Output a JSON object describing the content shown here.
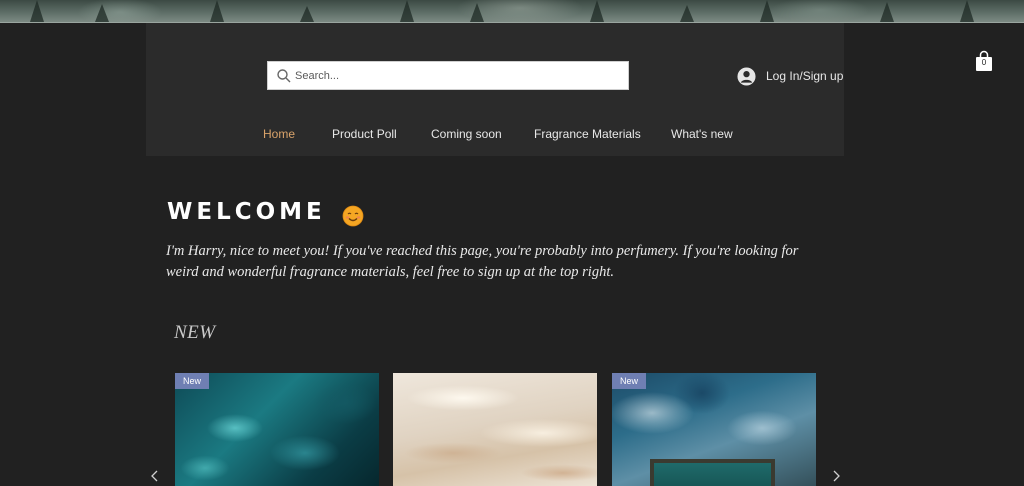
{
  "search": {
    "placeholder": "Search..."
  },
  "account": {
    "login_label": "Log In/Sign up"
  },
  "cart": {
    "count": "0"
  },
  "nav": {
    "items": [
      {
        "label": "Home",
        "active": true
      },
      {
        "label": "Product Poll",
        "active": false
      },
      {
        "label": "Coming soon",
        "active": false
      },
      {
        "label": "Fragrance Materials",
        "active": false
      },
      {
        "label": "What's new",
        "active": false
      }
    ]
  },
  "welcome": {
    "title": "WELCOME",
    "emoji_icon": "smiling-face-icon",
    "intro": "I'm Harry, nice to meet you! If you've reached this page, you're probably into perfumery. If you're looking for weird and wonderful fragrance materials, feel free to sign up at the top right."
  },
  "products": {
    "heading": "NEW",
    "cards": [
      {
        "badge": "New",
        "image": "turquoise-water-image"
      },
      {
        "badge": "",
        "image": "sand-dunes-image"
      },
      {
        "badge": "New",
        "image": "ocean-pool-aerial-image"
      }
    ]
  },
  "colors": {
    "background": "#212121",
    "header": "#2b2b2b",
    "nav_active": "#d9a36a",
    "badge": "#6f7fb3"
  }
}
